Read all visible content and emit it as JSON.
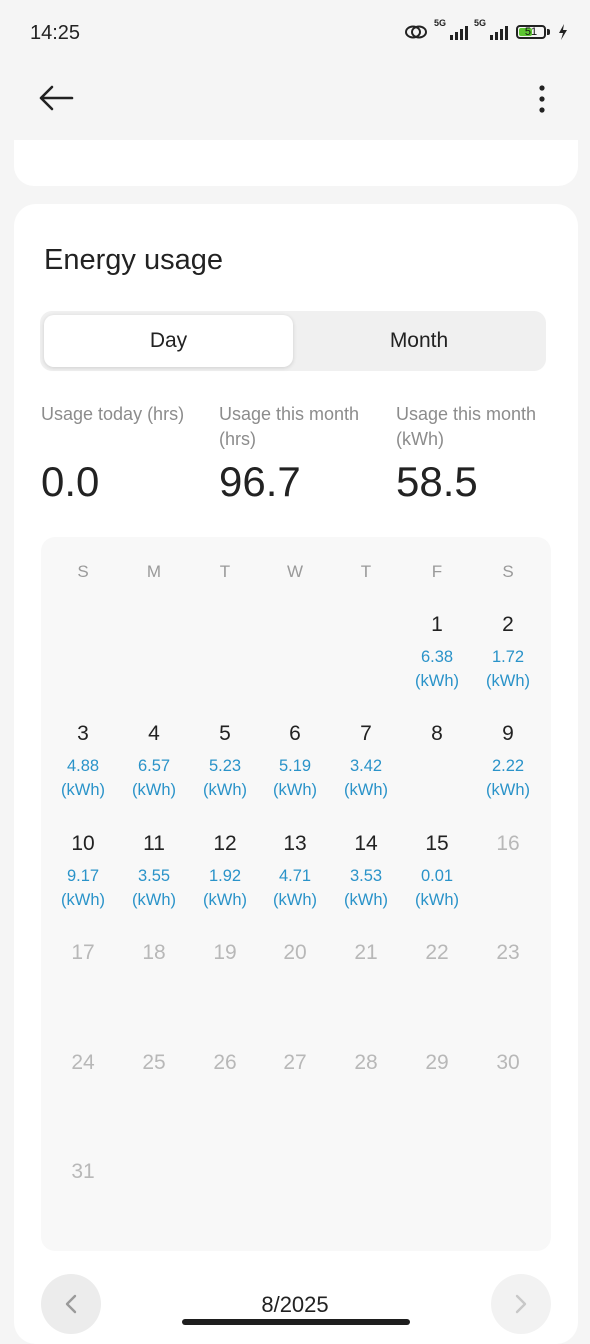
{
  "status_bar": {
    "time": "14:25",
    "battery": "51",
    "signal_1": "5G",
    "signal_2": "5G"
  },
  "icons": {
    "back": "back-arrow-icon",
    "more": "more-vertical-icon",
    "prev": "chevron-left-icon",
    "next": "chevron-right-icon",
    "link": "link-icon",
    "charging": "lightning-icon"
  },
  "colors": {
    "energy_text": "#2a93c9",
    "battery_fill": "#5cc531"
  },
  "section": {
    "title": "Energy usage"
  },
  "tabs": {
    "day": "Day",
    "month": "Month",
    "selected": "Day"
  },
  "stats": [
    {
      "label_line1": "Usage today (hrs)",
      "label_line2": "",
      "value": "0.0"
    },
    {
      "label_line1": "Usage this month",
      "label_line2": "(hrs)",
      "value": "96.7"
    },
    {
      "label_line1": "Usage this month",
      "label_line2": "(kWh)",
      "value": "58.5"
    }
  ],
  "calendar": {
    "weekdays": [
      "S",
      "M",
      "T",
      "W",
      "T",
      "F",
      "S"
    ],
    "unit": "(kWh)",
    "days": [
      {
        "day": "1",
        "value": "6.38",
        "active": true
      },
      {
        "day": "2",
        "value": "1.72",
        "active": true
      },
      {
        "day": "3",
        "value": "4.88",
        "active": true
      },
      {
        "day": "4",
        "value": "6.57",
        "active": true
      },
      {
        "day": "5",
        "value": "5.23",
        "active": true
      },
      {
        "day": "6",
        "value": "5.19",
        "active": true
      },
      {
        "day": "7",
        "value": "3.42",
        "active": true
      },
      {
        "day": "8",
        "value": "",
        "active": true
      },
      {
        "day": "9",
        "value": "2.22",
        "active": true
      },
      {
        "day": "10",
        "value": "9.17",
        "active": true
      },
      {
        "day": "11",
        "value": "3.55",
        "active": true
      },
      {
        "day": "12",
        "value": "1.92",
        "active": true
      },
      {
        "day": "13",
        "value": "4.71",
        "active": true
      },
      {
        "day": "14",
        "value": "3.53",
        "active": true
      },
      {
        "day": "15",
        "value": "0.01",
        "active": true
      },
      {
        "day": "16",
        "value": "",
        "active": false
      },
      {
        "day": "17",
        "value": "",
        "active": false
      },
      {
        "day": "18",
        "value": "",
        "active": false
      },
      {
        "day": "19",
        "value": "",
        "active": false
      },
      {
        "day": "20",
        "value": "",
        "active": false
      },
      {
        "day": "21",
        "value": "",
        "active": false
      },
      {
        "day": "22",
        "value": "",
        "active": false
      },
      {
        "day": "23",
        "value": "",
        "active": false
      },
      {
        "day": "24",
        "value": "",
        "active": false
      },
      {
        "day": "25",
        "value": "",
        "active": false
      },
      {
        "day": "26",
        "value": "",
        "active": false
      },
      {
        "day": "27",
        "value": "",
        "active": false
      },
      {
        "day": "28",
        "value": "",
        "active": false
      },
      {
        "day": "29",
        "value": "",
        "active": false
      },
      {
        "day": "30",
        "value": "",
        "active": false
      },
      {
        "day": "31",
        "value": "",
        "active": false
      }
    ]
  },
  "month_nav": {
    "label": "8/2025"
  }
}
